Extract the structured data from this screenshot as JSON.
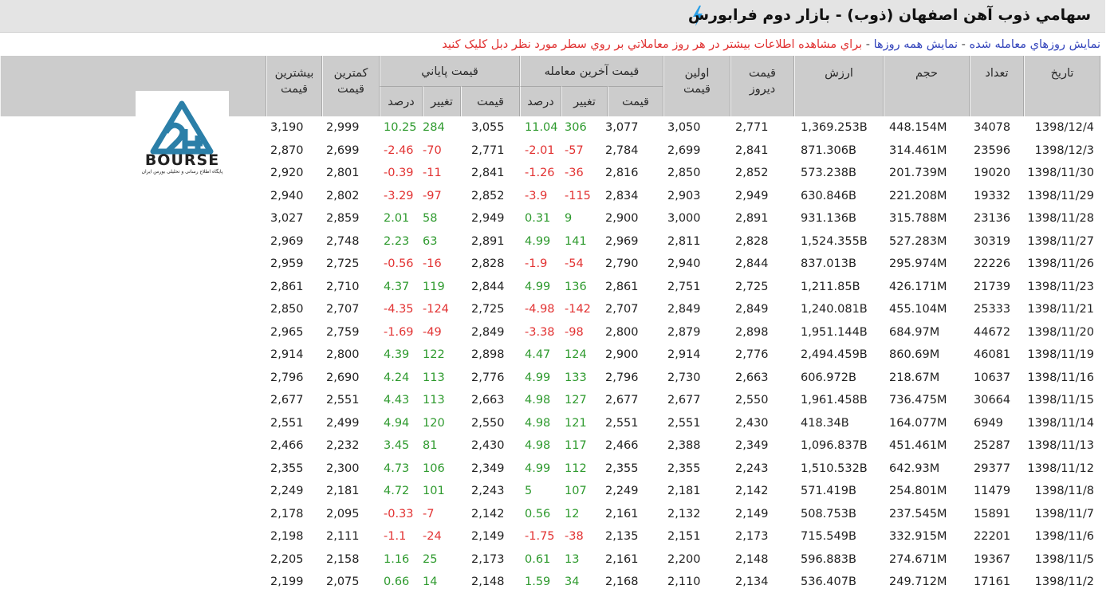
{
  "title": "سهامي ذوب آهن اصفهان (ذوب) - بازار دوم فرابورس",
  "info": {
    "shown_text": "نمايش روزهاي معامله شده",
    "sep": " - ",
    "all_link": "نمايش همه روزها",
    "hint": "براي مشاهده اطلاعات بيشتر در هر روز معاملاتي بر روي سطر مورد نظر دبل کليک کنيد"
  },
  "logo": {
    "text": "BOURSE",
    "tagline": "پایگاه اطلاع رسانی و تحلیلی بورس ایران"
  },
  "headers": {
    "date": "تاريخ",
    "count": "تعداد",
    "volume": "حجم",
    "value": "ارزش",
    "yesterday": "قيمت ديروز",
    "first": "اولين قيمت",
    "last_trade": "قيمت آخرين معامله",
    "final": "قيمت پاياني",
    "low": "کمترين قيمت",
    "high": "بيشترين قيمت",
    "sub_price": "قيمت",
    "sub_change": "تغيير",
    "sub_percent": "درصد"
  },
  "rows": [
    {
      "date": "1398/12/4",
      "count": "34078",
      "volume": "448.154M",
      "value": "1,369.253B",
      "yesterday": "2,771",
      "first": "3,050",
      "last_price": "3,077",
      "last_change": "306",
      "last_pct": "11.04",
      "final_price": "3,055",
      "final_change": "284",
      "final_pct": "10.25",
      "low": "2,999",
      "high": "3,190"
    },
    {
      "date": "1398/12/3",
      "count": "23596",
      "volume": "314.461M",
      "value": "871.306B",
      "yesterday": "2,841",
      "first": "2,699",
      "last_price": "2,784",
      "last_change": "-57",
      "last_pct": "-2.01",
      "final_price": "2,771",
      "final_change": "-70",
      "final_pct": "-2.46",
      "low": "2,699",
      "high": "2,870"
    },
    {
      "date": "1398/11/30",
      "count": "19020",
      "volume": "201.739M",
      "value": "573.238B",
      "yesterday": "2,852",
      "first": "2,850",
      "last_price": "2,816",
      "last_change": "-36",
      "last_pct": "-1.26",
      "final_price": "2,841",
      "final_change": "-11",
      "final_pct": "-0.39",
      "low": "2,801",
      "high": "2,920"
    },
    {
      "date": "1398/11/29",
      "count": "19332",
      "volume": "221.208M",
      "value": "630.846B",
      "yesterday": "2,949",
      "first": "2,903",
      "last_price": "2,834",
      "last_change": "-115",
      "last_pct": "-3.9",
      "final_price": "2,852",
      "final_change": "-97",
      "final_pct": "-3.29",
      "low": "2,802",
      "high": "2,940"
    },
    {
      "date": "1398/11/28",
      "count": "23136",
      "volume": "315.788M",
      "value": "931.136B",
      "yesterday": "2,891",
      "first": "3,000",
      "last_price": "2,900",
      "last_change": "9",
      "last_pct": "0.31",
      "final_price": "2,949",
      "final_change": "58",
      "final_pct": "2.01",
      "low": "2,859",
      "high": "3,027"
    },
    {
      "date": "1398/11/27",
      "count": "30319",
      "volume": "527.283M",
      "value": "1,524.355B",
      "yesterday": "2,828",
      "first": "2,811",
      "last_price": "2,969",
      "last_change": "141",
      "last_pct": "4.99",
      "final_price": "2,891",
      "final_change": "63",
      "final_pct": "2.23",
      "low": "2,748",
      "high": "2,969"
    },
    {
      "date": "1398/11/26",
      "count": "22226",
      "volume": "295.974M",
      "value": "837.013B",
      "yesterday": "2,844",
      "first": "2,940",
      "last_price": "2,790",
      "last_change": "-54",
      "last_pct": "-1.9",
      "final_price": "2,828",
      "final_change": "-16",
      "final_pct": "-0.56",
      "low": "2,725",
      "high": "2,959"
    },
    {
      "date": "1398/11/23",
      "count": "21739",
      "volume": "426.171M",
      "value": "1,211.85B",
      "yesterday": "2,725",
      "first": "2,751",
      "last_price": "2,861",
      "last_change": "136",
      "last_pct": "4.99",
      "final_price": "2,844",
      "final_change": "119",
      "final_pct": "4.37",
      "low": "2,710",
      "high": "2,861"
    },
    {
      "date": "1398/11/21",
      "count": "25333",
      "volume": "455.104M",
      "value": "1,240.081B",
      "yesterday": "2,849",
      "first": "2,849",
      "last_price": "2,707",
      "last_change": "-142",
      "last_pct": "-4.98",
      "final_price": "2,725",
      "final_change": "-124",
      "final_pct": "-4.35",
      "low": "2,707",
      "high": "2,850"
    },
    {
      "date": "1398/11/20",
      "count": "44672",
      "volume": "684.97M",
      "value": "1,951.144B",
      "yesterday": "2,898",
      "first": "2,879",
      "last_price": "2,800",
      "last_change": "-98",
      "last_pct": "-3.38",
      "final_price": "2,849",
      "final_change": "-49",
      "final_pct": "-1.69",
      "low": "2,759",
      "high": "2,965"
    },
    {
      "date": "1398/11/19",
      "count": "46081",
      "volume": "860.69M",
      "value": "2,494.459B",
      "yesterday": "2,776",
      "first": "2,914",
      "last_price": "2,900",
      "last_change": "124",
      "last_pct": "4.47",
      "final_price": "2,898",
      "final_change": "122",
      "final_pct": "4.39",
      "low": "2,800",
      "high": "2,914"
    },
    {
      "date": "1398/11/16",
      "count": "10637",
      "volume": "218.67M",
      "value": "606.972B",
      "yesterday": "2,663",
      "first": "2,730",
      "last_price": "2,796",
      "last_change": "133",
      "last_pct": "4.99",
      "final_price": "2,776",
      "final_change": "113",
      "final_pct": "4.24",
      "low": "2,690",
      "high": "2,796"
    },
    {
      "date": "1398/11/15",
      "count": "30664",
      "volume": "736.475M",
      "value": "1,961.458B",
      "yesterday": "2,550",
      "first": "2,677",
      "last_price": "2,677",
      "last_change": "127",
      "last_pct": "4.98",
      "final_price": "2,663",
      "final_change": "113",
      "final_pct": "4.43",
      "low": "2,551",
      "high": "2,677"
    },
    {
      "date": "1398/11/14",
      "count": "6949",
      "volume": "164.077M",
      "value": "418.34B",
      "yesterday": "2,430",
      "first": "2,551",
      "last_price": "2,551",
      "last_change": "121",
      "last_pct": "4.98",
      "final_price": "2,550",
      "final_change": "120",
      "final_pct": "4.94",
      "low": "2,499",
      "high": "2,551"
    },
    {
      "date": "1398/11/13",
      "count": "25287",
      "volume": "451.461M",
      "value": "1,096.837B",
      "yesterday": "2,349",
      "first": "2,388",
      "last_price": "2,466",
      "last_change": "117",
      "last_pct": "4.98",
      "final_price": "2,430",
      "final_change": "81",
      "final_pct": "3.45",
      "low": "2,232",
      "high": "2,466"
    },
    {
      "date": "1398/11/12",
      "count": "29377",
      "volume": "642.93M",
      "value": "1,510.532B",
      "yesterday": "2,243",
      "first": "2,355",
      "last_price": "2,355",
      "last_change": "112",
      "last_pct": "4.99",
      "final_price": "2,349",
      "final_change": "106",
      "final_pct": "4.73",
      "low": "2,300",
      "high": "2,355"
    },
    {
      "date": "1398/11/8",
      "count": "11479",
      "volume": "254.801M",
      "value": "571.419B",
      "yesterday": "2,142",
      "first": "2,181",
      "last_price": "2,249",
      "last_change": "107",
      "last_pct": "5",
      "final_price": "2,243",
      "final_change": "101",
      "final_pct": "4.72",
      "low": "2,181",
      "high": "2,249"
    },
    {
      "date": "1398/11/7",
      "count": "15891",
      "volume": "237.545M",
      "value": "508.753B",
      "yesterday": "2,149",
      "first": "2,132",
      "last_price": "2,161",
      "last_change": "12",
      "last_pct": "0.56",
      "final_price": "2,142",
      "final_change": "-7",
      "final_pct": "-0.33",
      "low": "2,095",
      "high": "2,178"
    },
    {
      "date": "1398/11/6",
      "count": "22201",
      "volume": "332.915M",
      "value": "715.549B",
      "yesterday": "2,173",
      "first": "2,151",
      "last_price": "2,135",
      "last_change": "-38",
      "last_pct": "-1.75",
      "final_price": "2,149",
      "final_change": "-24",
      "final_pct": "-1.1",
      "low": "2,111",
      "high": "2,198"
    },
    {
      "date": "1398/11/5",
      "count": "19367",
      "volume": "274.671M",
      "value": "596.883B",
      "yesterday": "2,148",
      "first": "2,200",
      "last_price": "2,161",
      "last_change": "13",
      "last_pct": "0.61",
      "final_price": "2,173",
      "final_change": "25",
      "final_pct": "1.16",
      "low": "2,158",
      "high": "2,205"
    },
    {
      "date": "1398/11/2",
      "count": "17161",
      "volume": "249.712M",
      "value": "536.407B",
      "yesterday": "2,134",
      "first": "2,110",
      "last_price": "2,168",
      "last_change": "34",
      "last_pct": "1.59",
      "final_price": "2,148",
      "final_change": "14",
      "final_pct": "0.66",
      "low": "2,075",
      "high": "2,199"
    }
  ]
}
